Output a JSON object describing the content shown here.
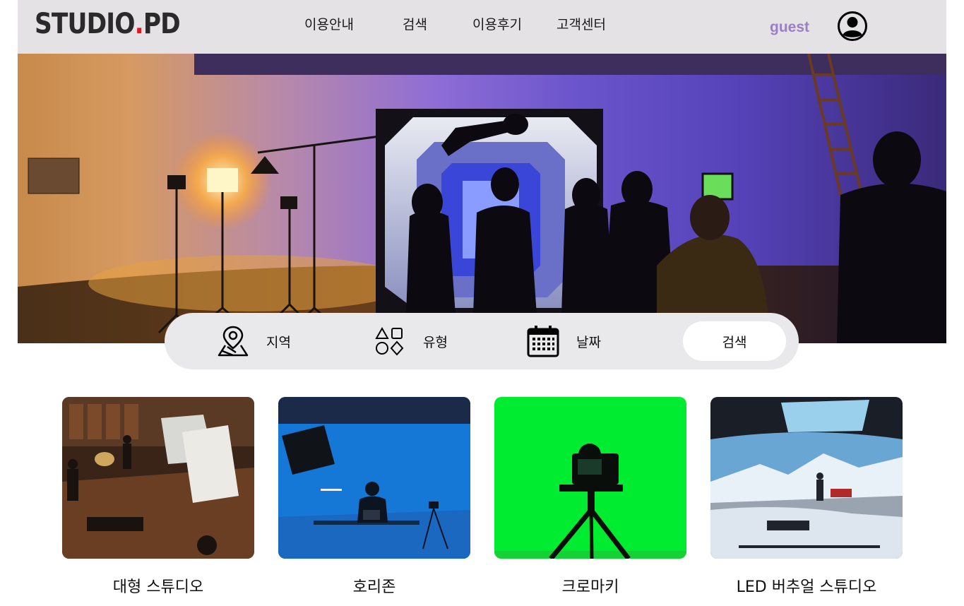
{
  "header": {
    "logo_main": "STUDIO",
    "logo_dot": ".",
    "logo_tail": "PD",
    "nav": [
      {
        "label": "이용안내"
      },
      {
        "label": "검색"
      },
      {
        "label": "이용후기"
      },
      {
        "label": "고객센터"
      }
    ],
    "user_label": "guest",
    "profile_icon": "user-circle-icon"
  },
  "search_bar": {
    "region_label": "지역",
    "region_icon": "map-pin-icon",
    "type_label": "유형",
    "type_icon": "shapes-icon",
    "date_label": "날짜",
    "date_icon": "calendar-icon",
    "search_button": "검색"
  },
  "categories": [
    {
      "label": "대형 스튜디오"
    },
    {
      "label": "호리존"
    },
    {
      "label": "크로마키"
    },
    {
      "label": "LED 버추얼 스튜디오"
    }
  ],
  "colors": {
    "header_bg": "#e4e2e4",
    "logo_dot": "#e8141c",
    "guest": "#9a7ec8",
    "chroma_green": "#00e832"
  }
}
